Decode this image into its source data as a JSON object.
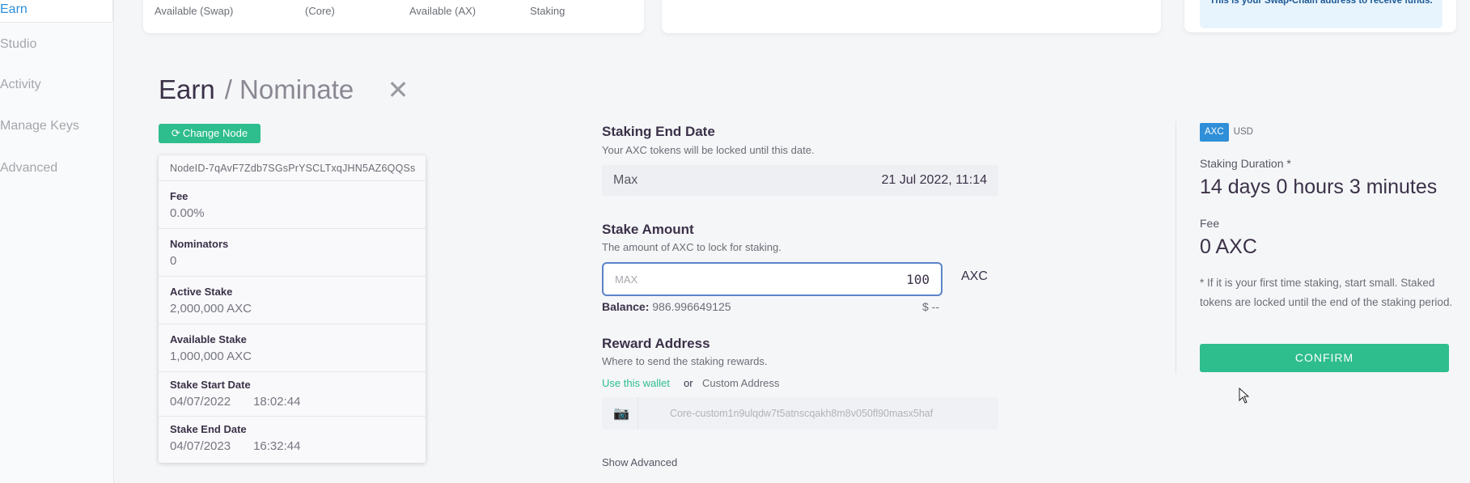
{
  "sidebar": {
    "items": [
      {
        "label": "Earn",
        "active": true
      },
      {
        "label": "Studio"
      },
      {
        "label": "Activity"
      },
      {
        "label": "Manage Keys"
      },
      {
        "label": "Advanced"
      }
    ]
  },
  "top_cards": {
    "card1_labels": [
      "Available (Swap)",
      "(Core)",
      "Available (AX)",
      "Staking"
    ],
    "notice": "This is your Swap-Chain address to receive funds."
  },
  "header": {
    "title": "Earn",
    "subtitle": "/ Nominate"
  },
  "change_node_label": "Change Node",
  "node": {
    "id": "NodeID-7qAvF7Zdb7SGsPrYSCLTxqJHN5AZ6QQSs",
    "fee_label": "Fee",
    "fee_value": "0.00%",
    "nominators_label": "Nominators",
    "nominators_value": "0",
    "active_stake_label": "Active Stake",
    "active_stake_value": "2,000,000 AXC",
    "available_stake_label": "Available Stake",
    "available_stake_value": "1,000,000 AXC",
    "start_label": "Stake Start Date",
    "start_date": "04/07/2022",
    "start_time": "18:02:44",
    "end_label": "Stake End Date",
    "end_date": "04/07/2023",
    "end_time": "16:32:44"
  },
  "staking_end": {
    "title": "Staking End Date",
    "desc": "Your AXC tokens will be locked until this date.",
    "max_label": "Max",
    "date": "21 Jul 2022, 11:14"
  },
  "stake_amount": {
    "title": "Stake Amount",
    "desc": "The amount of AXC to lock for staking.",
    "placeholder": "MAX",
    "value": "100",
    "unit": "AXC",
    "balance_label": "Balance:",
    "balance_value": "986.996649125",
    "usd": "$ --"
  },
  "reward": {
    "title": "Reward Address",
    "desc": "Where to send the staking rewards.",
    "use_wallet": "Use this wallet",
    "or": "or",
    "custom": "Custom Address",
    "address": "Core-custom1n9ulqdw7t5atnscqakh8m8v050fl90masx5haf"
  },
  "show_advanced": "Show Advanced",
  "summary": {
    "toggle_on": "AXC",
    "toggle_off": "USD",
    "duration_label": "Staking Duration *",
    "duration_value": "14 days 0 hours 3 minutes",
    "fee_label": "Fee",
    "fee_value": "0 AXC",
    "note": "* If it is your first time staking, start small. Staked tokens are locked until the end of the staking period.",
    "confirm": "CONFIRM"
  }
}
